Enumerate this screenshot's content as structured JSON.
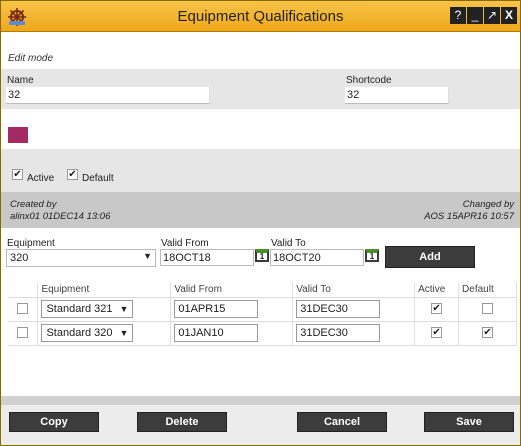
{
  "window": {
    "title": "Equipment Qualifications"
  },
  "window_controls": {
    "help": "?",
    "minimize": "_",
    "maximize": "↗",
    "close": "X"
  },
  "mode_label": "Edit mode",
  "form": {
    "name_label": "Name",
    "name_value": "32",
    "shortcode_label": "Shortcode",
    "shortcode_value": "32",
    "color": "#a42a63",
    "active_label": "Active",
    "active_checked": true,
    "default_label": "Default",
    "default_checked": true
  },
  "audit": {
    "created_label": "Created by",
    "created_value": "alinx01 01DEC14 13:06",
    "changed_label": "Changed by",
    "changed_value": "AOS 15APR16 10:57"
  },
  "add_row": {
    "equipment_label": "Equipment",
    "equipment_value": "320",
    "valid_from_label": "Valid From",
    "valid_from_value": "18OCT18",
    "valid_to_label": "Valid To",
    "valid_to_value": "18OCT20",
    "calendar_day": "1",
    "add_button": "Add"
  },
  "table": {
    "headers": {
      "equipment": "Equipment",
      "valid_from": "Valid From",
      "valid_to": "Valid To",
      "active": "Active",
      "default": "Default"
    },
    "rows": [
      {
        "equipment": "Standard 321",
        "valid_from": "01APR15",
        "valid_to": "31DEC30",
        "active": true,
        "default": false
      },
      {
        "equipment": "Standard 320",
        "valid_from": "01JAN10",
        "valid_to": "31DEC30",
        "active": true,
        "default": true
      }
    ]
  },
  "footer": {
    "copy": "Copy",
    "delete": "Delete",
    "cancel": "Cancel",
    "save": "Save"
  },
  "glyphs": {
    "check": "✔",
    "dropdown": "▼"
  }
}
